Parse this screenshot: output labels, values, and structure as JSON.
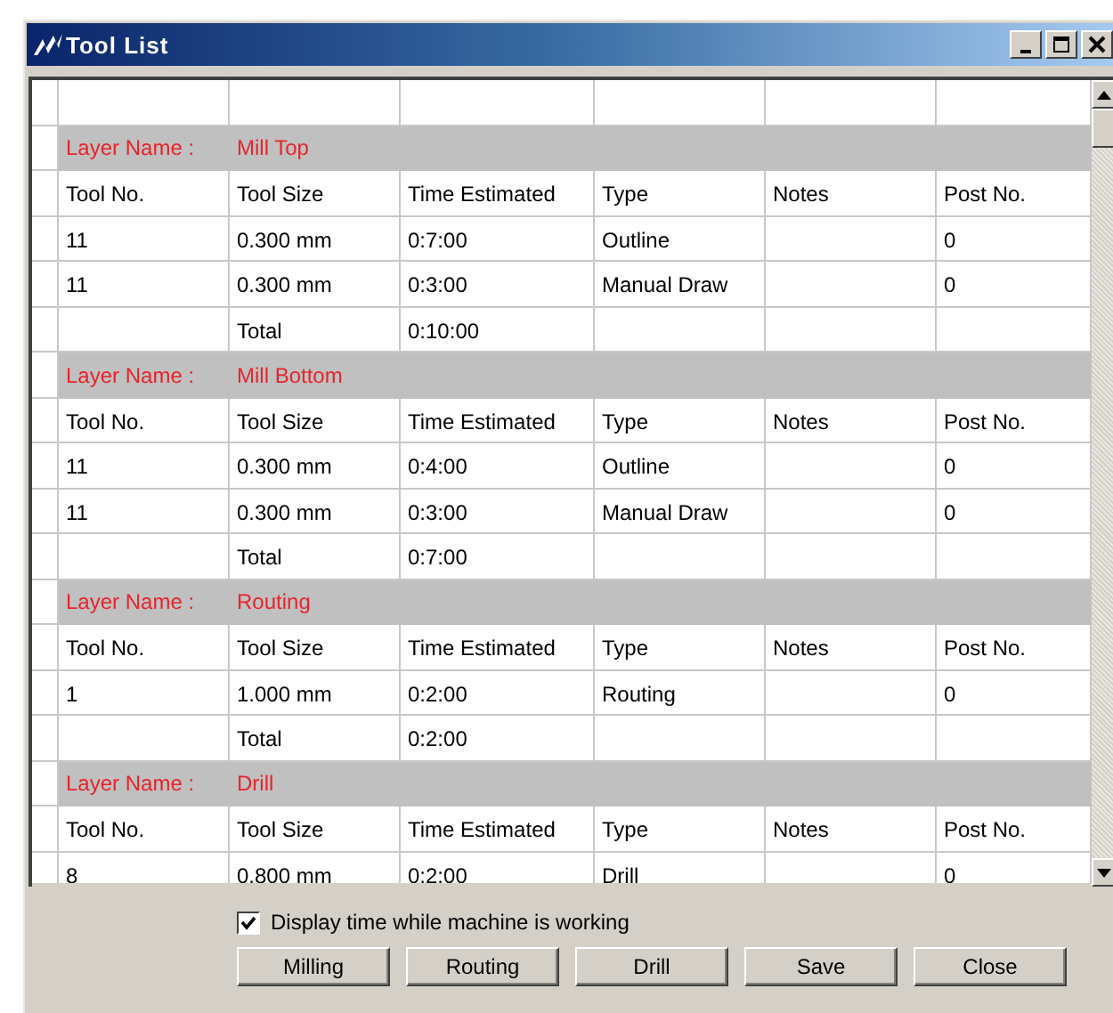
{
  "window": {
    "title": "Tool List"
  },
  "layers": [
    {
      "label": "Layer Name :",
      "name": "Mill Top",
      "columns": [
        "Tool No.",
        "Tool Size",
        "Time Estimated",
        "Type",
        "Notes",
        "Post No."
      ],
      "rows": [
        [
          "11",
          "0.300 mm",
          "0:7:00",
          "Outline",
          "",
          "0"
        ],
        [
          "11",
          "0.300 mm",
          "0:3:00",
          "Manual Draw",
          "",
          "0"
        ]
      ],
      "total": {
        "label": "Total",
        "time": "0:10:00"
      }
    },
    {
      "label": "Layer Name :",
      "name": "Mill Bottom",
      "columns": [
        "Tool No.",
        "Tool Size",
        "Time Estimated",
        "Type",
        "Notes",
        "Post No."
      ],
      "rows": [
        [
          "11",
          "0.300 mm",
          "0:4:00",
          "Outline",
          "",
          "0"
        ],
        [
          "11",
          "0.300 mm",
          "0:3:00",
          "Manual Draw",
          "",
          "0"
        ]
      ],
      "total": {
        "label": "Total",
        "time": "0:7:00"
      }
    },
    {
      "label": "Layer Name :",
      "name": "Routing",
      "columns": [
        "Tool No.",
        "Tool Size",
        "Time Estimated",
        "Type",
        "Notes",
        "Post No."
      ],
      "rows": [
        [
          "1",
          "1.000 mm",
          "0:2:00",
          "Routing",
          "",
          "0"
        ]
      ],
      "total": {
        "label": "Total",
        "time": "0:2:00"
      }
    },
    {
      "label": "Layer Name :",
      "name": "Drill",
      "columns": [
        "Tool No.",
        "Tool Size",
        "Time Estimated",
        "Type",
        "Notes",
        "Post No."
      ],
      "rows": [
        [
          "8",
          "0.800 mm",
          "0:2:00",
          "Drill",
          "",
          "0"
        ]
      ]
    }
  ],
  "display_time": {
    "label": "Display time while machine is working",
    "checked": true
  },
  "buttons": [
    "Milling",
    "Routing",
    "Drill",
    "Save",
    "Close"
  ]
}
